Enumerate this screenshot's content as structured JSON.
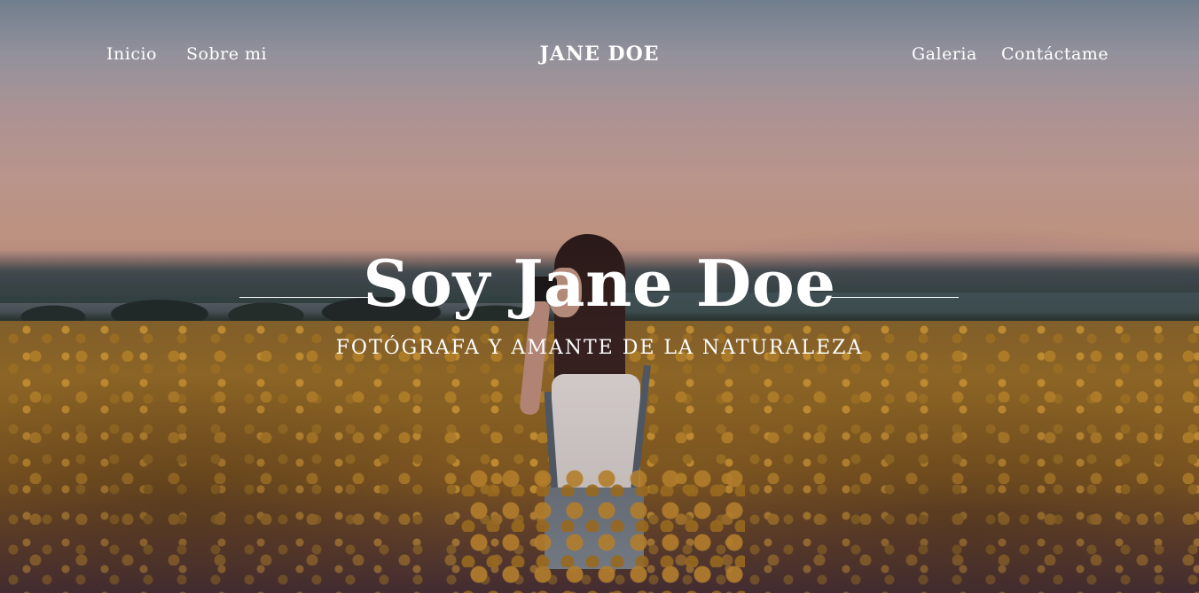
{
  "nav": {
    "left": [
      {
        "label": "Inicio"
      },
      {
        "label": "Sobre mi"
      }
    ],
    "brand": "JANE DOE",
    "right": [
      {
        "label": "Galeria"
      },
      {
        "label": "Contáctame"
      }
    ]
  },
  "hero": {
    "title": "Soy Jane Doe",
    "subtitle": "FOTÓGRAFA Y AMANTE DE LA NATURALEZA"
  },
  "colors": {
    "text": "#ffffff",
    "sky_top": "#7c8d9c",
    "sky_sunset": "#d3a48c",
    "field": "#9b7026"
  }
}
